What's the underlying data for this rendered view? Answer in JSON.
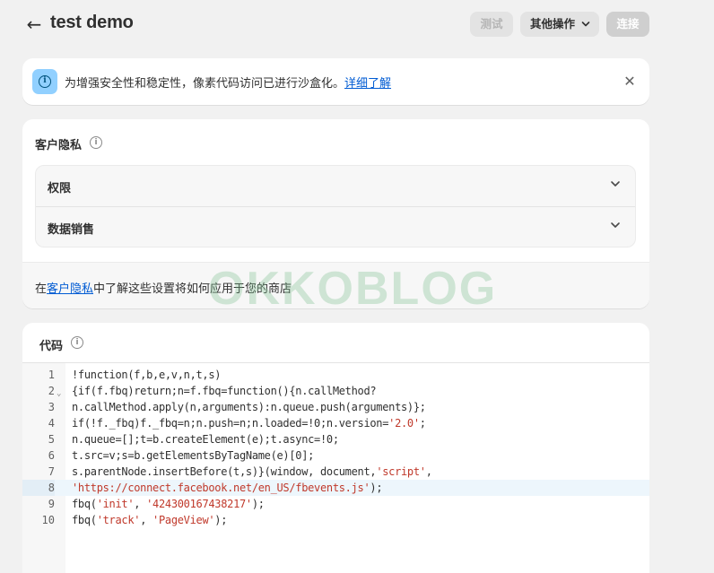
{
  "header": {
    "back_icon": "arrow-left-icon",
    "title": "test demo",
    "test_label": "测试",
    "more_label": "其他操作",
    "connect_label": "连接"
  },
  "banner": {
    "text": "为增强安全性和稳定性，像素代码访问已进行沙盒化。",
    "link": "详细了解",
    "close_icon": "close-icon",
    "info_icon": "info-icon"
  },
  "privacy": {
    "title": "客户隐私",
    "items": [
      {
        "label": "权限"
      },
      {
        "label": "数据销售"
      }
    ],
    "footer_prefix": "在",
    "footer_link": "客户隐私",
    "footer_suffix": "中了解这些设置将如何应用于您的商店"
  },
  "code": {
    "title": "代码",
    "active_line": 8,
    "lines": [
      {
        "n": "1",
        "text": "!function(f,b,e,v,n,t,s)"
      },
      {
        "n": "2",
        "text": "{if(f.fbq)return;n=f.fbq=function(){n.callMethod?"
      },
      {
        "n": "3",
        "text": "n.callMethod.apply(n,arguments):n.queue.push(arguments)};"
      },
      {
        "n": "4",
        "text": "if(!f._fbq)f._fbq=n;n.push=n;n.loaded=!0;n.version='2.0';"
      },
      {
        "n": "5",
        "text": "n.queue=[];t=b.createElement(e);t.async=!0;"
      },
      {
        "n": "6",
        "text": "t.src=v;s=b.getElementsByTagName(e)[0];"
      },
      {
        "n": "7",
        "text": "s.parentNode.insertBefore(t,s)}(window, document,'script',"
      },
      {
        "n": "8",
        "text": "'https://connect.facebook.net/en_US/fbevents.js');"
      },
      {
        "n": "9",
        "text": "fbq('init', '424300167438217');"
      },
      {
        "n": "10",
        "text": "fbq('track', 'PageView');"
      }
    ]
  },
  "watermark": "OKKOBLOG",
  "colors": {
    "background": "#f1f1f1",
    "link": "#005bd3",
    "string": "#c0392b",
    "info_badge": "#91d0ff"
  }
}
